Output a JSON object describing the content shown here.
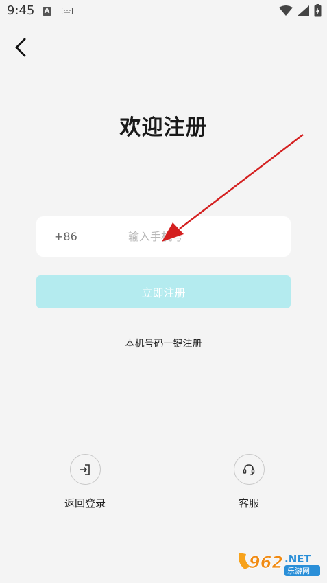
{
  "status_bar": {
    "time": "9:45",
    "icons": [
      "a-icon",
      "keyboard-icon",
      "wifi-icon",
      "signal-icon",
      "battery-icon"
    ]
  },
  "header": {
    "back_icon": "chevron-left-icon",
    "title": "欢迎注册"
  },
  "form": {
    "country_code": "+86",
    "phone_placeholder": "输入手机号",
    "phone_value": "",
    "submit_label": "立即注册",
    "one_click_label": "本机号码一键注册"
  },
  "actions": {
    "login": {
      "icon": "login-icon",
      "label": "返回登录"
    },
    "service": {
      "icon": "headset-icon",
      "label": "客服"
    }
  },
  "watermark": {
    "logo_text": "962",
    "net_text": ".NET",
    "sub_text": "乐游网"
  },
  "colors": {
    "background": "#f4f4f4",
    "button_disabled": "#b4ebef",
    "annotation_arrow": "#d42020"
  }
}
